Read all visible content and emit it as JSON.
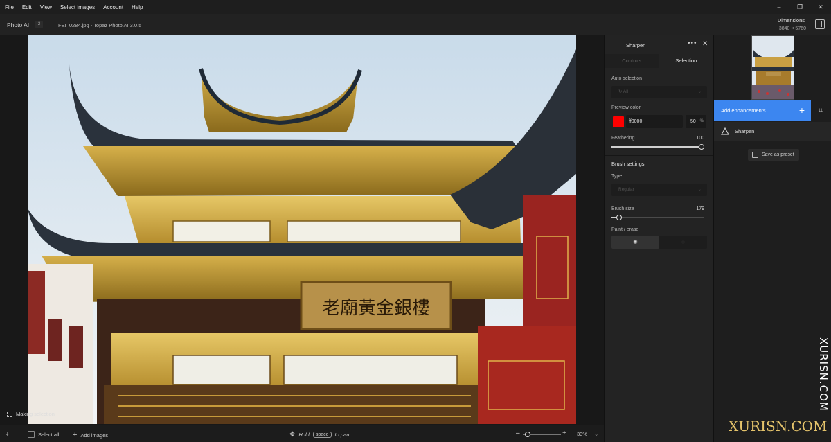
{
  "menu": [
    "File",
    "Edit",
    "View",
    "Select images",
    "Account",
    "Help"
  ],
  "window_controls": [
    "–",
    "❐",
    "✕"
  ],
  "titlebar": {
    "app_name": "Photo AI",
    "app_count": "2",
    "file_title": "FEI_0284.jpg - Topaz Photo AI 3.0.5",
    "dimensions_label": "Dimensions",
    "dimensions_value": "3840 × 5760"
  },
  "canvas": {
    "status": "Making selection",
    "signboard_text": "老廟黃金銀樓"
  },
  "bottombar": {
    "select_all": "Select all",
    "add_images": "Add images",
    "hold": "Hold",
    "key": "space",
    "to_pan": "to pan",
    "zoom": "33%"
  },
  "props": {
    "title": "Sharpen",
    "tabs": [
      "Controls",
      "Selection"
    ],
    "active_tab": "Selection",
    "auto_selection_label": "Auto selection",
    "auto_selection_value": "All",
    "preview_color_label": "Preview color",
    "preview_color_hex": "ff0000",
    "preview_opacity": "50",
    "preview_opacity_unit": "%",
    "feathering_label": "Feathering",
    "feathering_value": "100",
    "brush_settings_title": "Brush settings",
    "type_label": "Type",
    "type_value": "Regular",
    "brush_size_label": "Brush size",
    "brush_size_value": "179",
    "paint_erase_label": "Paint / erase"
  },
  "right_panel": {
    "add_enhancements": "Add enhancements",
    "enhancement_item": "Sharpen",
    "save_preset": "Save as preset"
  },
  "watermark": {
    "vertical": "XURISN.COM",
    "bottom": "XURISN.COM"
  },
  "colors": {
    "accent": "#3c86f0",
    "preview_swatch": "#ff0000"
  },
  "levels": {
    "feathering_fraction": 1.0,
    "brush_size_fraction": 0.08,
    "zoom_fraction": 0.1
  }
}
